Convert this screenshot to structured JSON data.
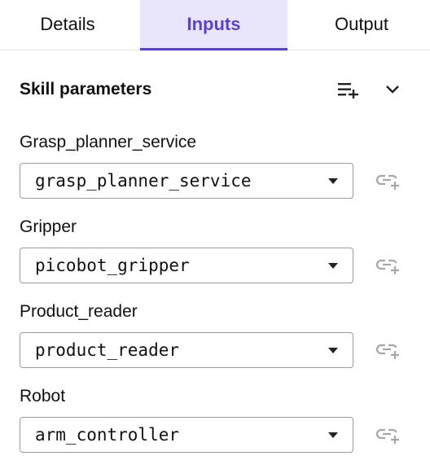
{
  "tabs": [
    {
      "label": "Details",
      "active": false
    },
    {
      "label": "Inputs",
      "active": true
    },
    {
      "label": "Output",
      "active": false
    }
  ],
  "section": {
    "title": "Skill parameters",
    "icons": [
      "add-to-list-icon",
      "chevron-down-icon"
    ]
  },
  "params": [
    {
      "label": "Grasp_planner_service",
      "value": "grasp_planner_service",
      "icon": "link-add-icon"
    },
    {
      "label": "Gripper",
      "value": "picobot_gripper",
      "icon": "link-add-icon"
    },
    {
      "label": "Product_reader",
      "value": "product_reader",
      "icon": "link-add-icon"
    },
    {
      "label": "Robot",
      "value": "arm_controller",
      "icon": "link-add-icon"
    }
  ],
  "colors": {
    "accent": "#5a3fd6",
    "active_tab_bg": "#e9e6fb",
    "border": "#9a9aa0",
    "icon_muted": "#a6a6ab"
  }
}
